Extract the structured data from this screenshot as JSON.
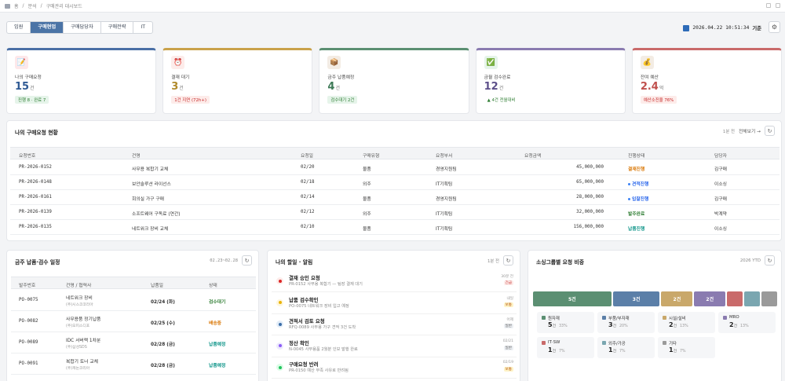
{
  "breadcrumb": {
    "home": "홈",
    "sep1": "/",
    "section": "분석",
    "sep2": "/",
    "current": "구매관리 대시보드"
  },
  "tabs": [
    {
      "label": "임원",
      "active": false
    },
    {
      "label": "구매현업",
      "active": true
    },
    {
      "label": "구매담당자",
      "active": false
    },
    {
      "label": "구매전략",
      "active": false
    },
    {
      "label": "IT",
      "active": false
    }
  ],
  "clock": {
    "datetime": "2026.04.22 10:51:34",
    "suffix": "기준"
  },
  "kpis": [
    {
      "label": "나의 구매요청",
      "value": "15",
      "unit": "건",
      "badge": "진행 8 · 완료 7",
      "color": "#4a6fa5",
      "icon": "📝",
      "icon_bg": "#fde8ea",
      "val_color": "#2f5a94",
      "badge_bg": "#e6f4ea",
      "badge_color": "#2e7d32"
    },
    {
      "label": "결재 대기",
      "value": "3",
      "unit": "건",
      "badge": "1건 지연 (72h+)",
      "color": "#c9a14a",
      "icon": "⏰",
      "icon_bg": "#fdecea",
      "val_color": "#b08a2a",
      "badge_bg": "#fdecea",
      "badge_color": "#c62828"
    },
    {
      "label": "금주 납품예정",
      "value": "4",
      "unit": "건",
      "badge": "검수대기 2건",
      "color": "#5b8f72",
      "icon": "📦",
      "icon_bg": "#f3ece4",
      "val_color": "#3e7a57",
      "badge_bg": "#e6f4ea",
      "badge_color": "#2e7d32"
    },
    {
      "label": "금월 검수완료",
      "value": "12",
      "unit": "건",
      "badge": "▲ 4건 전월대비",
      "color": "#8a7bb0",
      "icon": "✅",
      "icon_bg": "#e6f4ea",
      "val_color": "#5c4f8a",
      "badge_bg": "#ffffff",
      "badge_color": "#2e7d32"
    },
    {
      "label": "잔여 예산",
      "value": "2.4",
      "unit": "억",
      "badge": "예산소진율 76%",
      "color": "#c96a6a",
      "icon": "💰",
      "icon_bg": "#f3ece4",
      "val_color": "#c0504d",
      "badge_bg": "#fdecea",
      "badge_color": "#c62828"
    }
  ],
  "my_requests": {
    "title": "나의 구매요청 현황",
    "meta": "1분 전",
    "more": "전체보기 →",
    "columns": [
      "요청번호",
      "건명",
      "요청일",
      "구매유형",
      "요청부서",
      "요청금액",
      "진행상태",
      "담당자"
    ],
    "rows": [
      {
        "id": "PR-2026-0152",
        "name": "사무용 복합기 교체",
        "date": "02/20",
        "type": "물품",
        "dept": "경영지원팀",
        "amount": "45,000,000",
        "status": "결재진행",
        "status_color": "#d97706",
        "dot": false,
        "owner": "김구매"
      },
      {
        "id": "PR-2026-0148",
        "name": "보안솔루션 라이선스",
        "date": "02/18",
        "type": "외주",
        "dept": "IT기획팀",
        "amount": "65,000,000",
        "status": "견적진행",
        "status_color": "#2563eb",
        "dot": true,
        "owner": "이소싱"
      },
      {
        "id": "PR-2026-0161",
        "name": "회의실 가구 구매",
        "date": "02/14",
        "type": "물품",
        "dept": "경영지원팀",
        "amount": "28,000,000",
        "status": "입찰진행",
        "status_color": "#2563eb",
        "dot": true,
        "owner": "김구매"
      },
      {
        "id": "PR-2026-0139",
        "name": "소프트웨어 구독료 (연간)",
        "date": "02/12",
        "type": "외주",
        "dept": "IT기획팀",
        "amount": "32,000,000",
        "status": "발주완료",
        "status_color": "#2e7d32",
        "dot": false,
        "owner": "박계약"
      },
      {
        "id": "PR-2026-0135",
        "name": "네트워크 장비 교체",
        "date": "02/10",
        "type": "물품",
        "dept": "IT기획팀",
        "amount": "156,000,000",
        "status": "납품진행",
        "status_color": "#0d9488",
        "dot": false,
        "owner": "이소싱"
      }
    ]
  },
  "delivery": {
    "title": "금주 납품·검수 일정",
    "range": "02.23~02.28",
    "columns": [
      "발주번호",
      "건명 / 협력사",
      "납품일",
      "상태"
    ],
    "rows": [
      {
        "id": "PO-0075",
        "name": "네트워크 장비",
        "vendor": "(주)시스코코리아",
        "date": "02/24 (화)",
        "status": "검수대기",
        "status_color": "#2e7d32"
      },
      {
        "id": "PO-0082",
        "name": "사무용품 정기납품",
        "vendor": "(주)오피스디포",
        "date": "02/25 (수)",
        "status": "배송중",
        "status_color": "#d97706"
      },
      {
        "id": "PO-0089",
        "name": "IDC 서버랙 1차분",
        "vendor": "(주)삼성SDS",
        "date": "02/28 (금)",
        "status": "납품예정",
        "status_color": "#0d9488"
      },
      {
        "id": "PO-0091",
        "name": "복합기 토너 교체",
        "vendor": "(주)캐논코리아",
        "date": "02/28 (금)",
        "status": "납품예정",
        "status_color": "#0d9488"
      }
    ]
  },
  "todos": {
    "title": "나의 할일 · 알림",
    "meta": "1분 전",
    "items": [
      {
        "title": "결재 승인 요청",
        "desc": "PR-0152 사무용 복합기 — 팀장 결재 대기",
        "time": "30분 전",
        "tag": "긴급",
        "color": "#dc2626",
        "bg": "#fdecea",
        "tag_bg": "#fdecea",
        "tag_color": "#c62828"
      },
      {
        "title": "납품 검수확인",
        "desc": "PO-0075 네트워크 장비 입고 예정",
        "time": "내일",
        "tag": "보통",
        "color": "#eab308",
        "bg": "#fef6dc",
        "tag_bg": "#fef3c7",
        "tag_color": "#b45309"
      },
      {
        "title": "견적서 검토 요청",
        "desc": "RFQ-0089 사무용 가구 견적 3건 도착",
        "time": "어제",
        "tag": "일반",
        "color": "#3b6ea8",
        "bg": "#e3edf8",
        "tag_bg": "#eceff3",
        "tag_color": "#555555"
      },
      {
        "title": "정산 확인",
        "desc": "N-0045 사무용품 2월분 인보 발행 완료",
        "time": "02/21",
        "tag": "일반",
        "color": "#8b5cf6",
        "bg": "#ede9fe",
        "tag_bg": "#eceff3",
        "tag_color": "#555555"
      },
      {
        "title": "구매요청 반려",
        "desc": "PR-0150 예산 부족 사유로 반려됨",
        "time": "02/19",
        "tag": "보통",
        "color": "#22c55e",
        "bg": "#dcfce7",
        "tag_bg": "#fef3c7",
        "tag_color": "#b45309"
      }
    ]
  },
  "sourcing": {
    "title": "소싱그룹별 요청 비중",
    "period": "2026 YTD",
    "segments": [
      {
        "name": "원자재",
        "count": 5,
        "label": "5건",
        "pct": "33%",
        "color": "#5b8f72"
      },
      {
        "name": "부품/부자재",
        "count": 3,
        "label": "3건",
        "pct": "20%",
        "color": "#5b7fa8"
      },
      {
        "name": "시설/설비",
        "count": 2,
        "label": "2건",
        "pct": "13%",
        "color": "#c9a86a"
      },
      {
        "name": "MRO",
        "count": 2,
        "label": "2건",
        "pct": "13%",
        "color": "#8a7bb0"
      },
      {
        "name": "IT·SW",
        "count": 1,
        "label": "",
        "pct": "7%",
        "color": "#c96a6a"
      },
      {
        "name": "외주/가공",
        "count": 1,
        "label": "",
        "pct": "7%",
        "color": "#7aa6b0"
      },
      {
        "name": "기타",
        "count": 1,
        "label": "",
        "pct": "7%",
        "color": "#9a9a9a"
      }
    ],
    "unit": "건"
  },
  "icons": {
    "home": "home-icon",
    "calendar": "calendar-icon",
    "settings": "gear-icon",
    "refresh": "refresh-icon"
  }
}
